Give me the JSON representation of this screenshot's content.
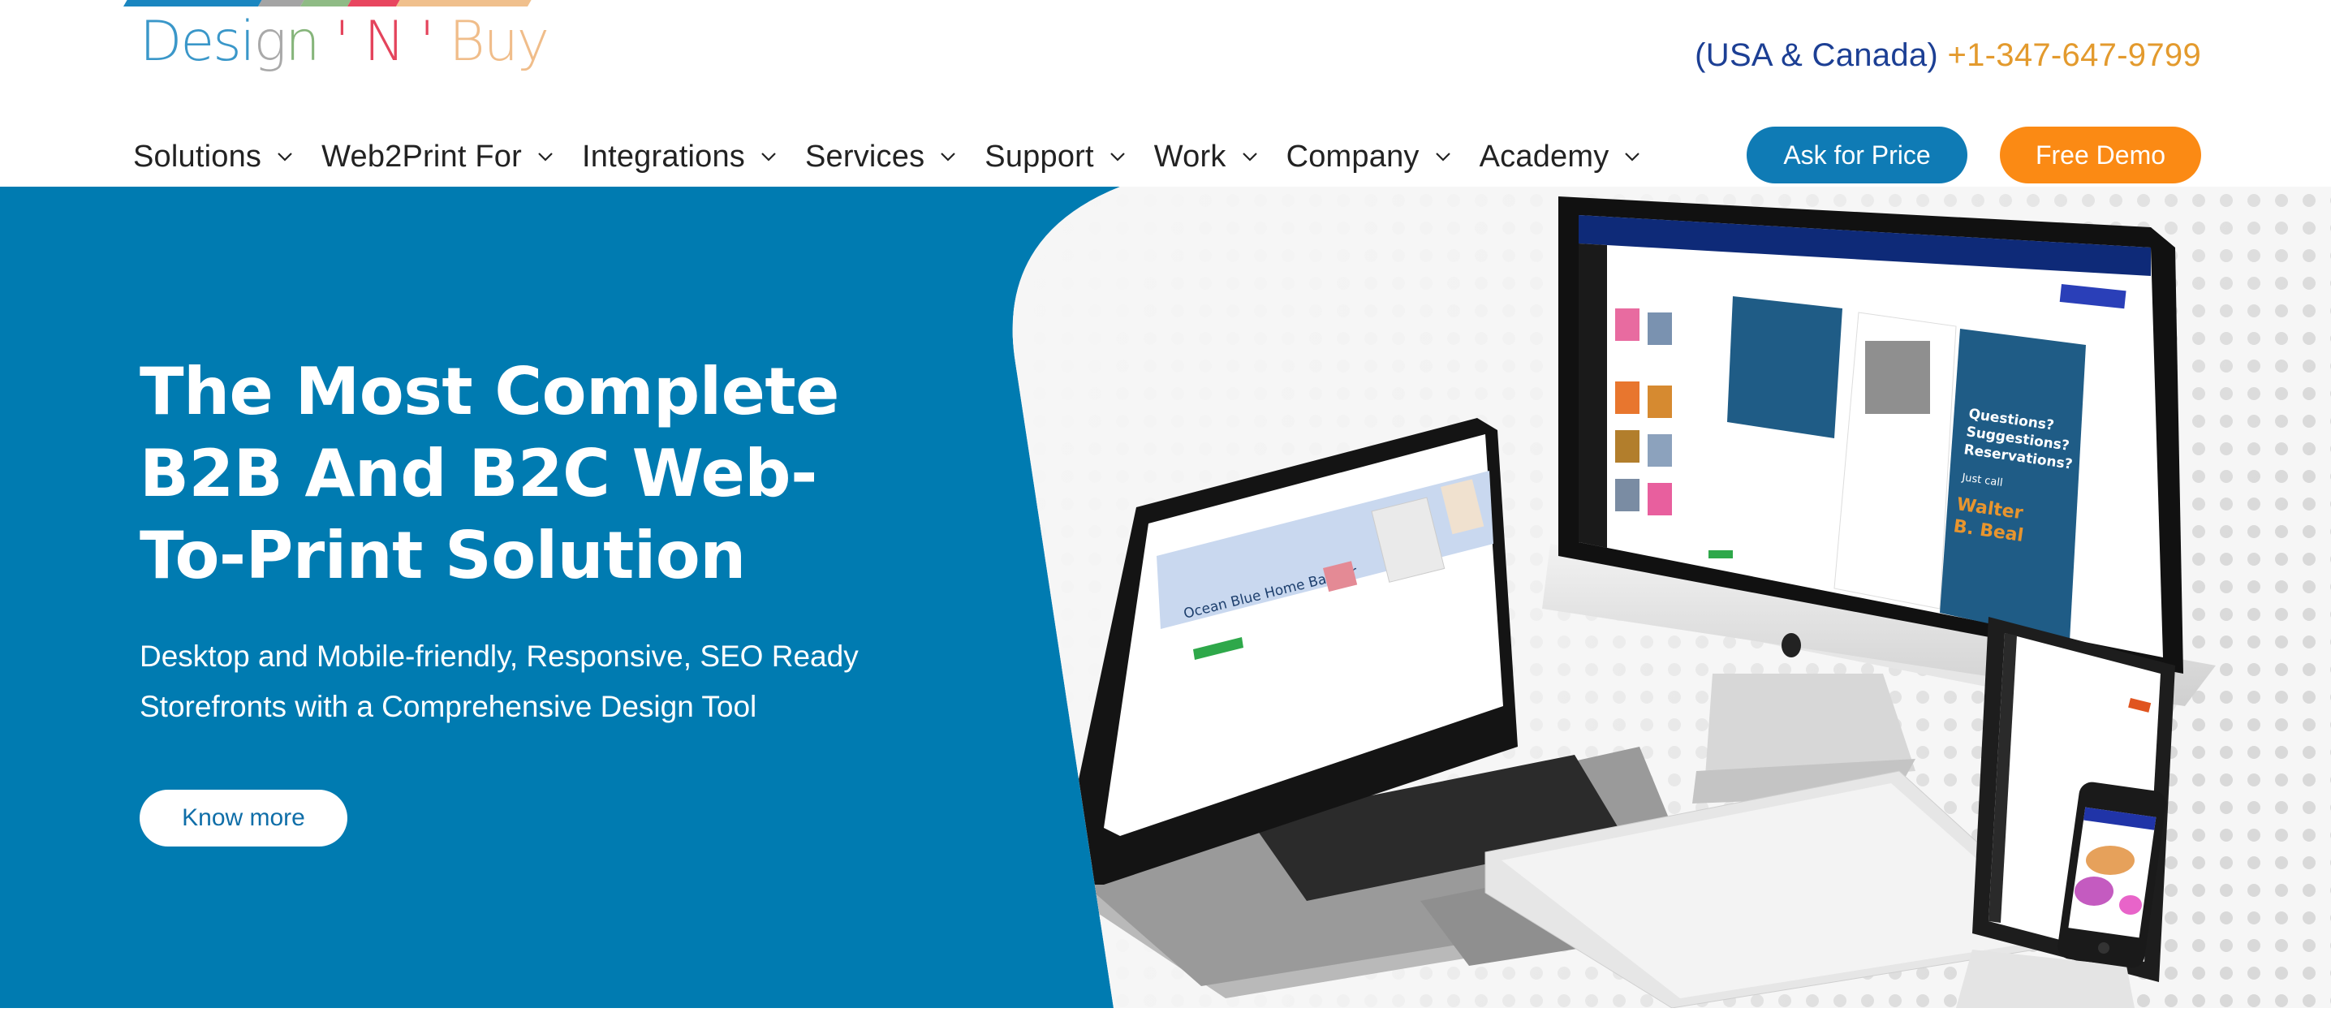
{
  "brand": {
    "logo_parts": [
      {
        "text": "Desi",
        "color": "#3a97c9"
      },
      {
        "text": "g",
        "color": "#a9a9a9"
      },
      {
        "text": "n",
        "color": "#86b57b"
      },
      {
        "text": " ' N ' ",
        "color": "#e4445c"
      },
      {
        "text": "Buy",
        "color": "#f0bd8a"
      }
    ],
    "stripe_colors": [
      "#1a86c0",
      "#a4a4a4",
      "#8fbb85",
      "#e8465f",
      "#f0c08d"
    ]
  },
  "contact": {
    "region": "(USA & Canada)",
    "phone": "+1-347-647-9799"
  },
  "nav": {
    "items": [
      {
        "label": "Solutions"
      },
      {
        "label": "Web2Print For"
      },
      {
        "label": "Integrations"
      },
      {
        "label": "Services"
      },
      {
        "label": "Support"
      },
      {
        "label": "Work"
      },
      {
        "label": "Company"
      },
      {
        "label": "Academy"
      }
    ],
    "ask_price_label": "Ask for Price",
    "free_demo_label": "Free Demo"
  },
  "hero": {
    "title_lines": [
      "The Most Complete",
      "B2B And B2C Web-",
      "To-Print Solution"
    ],
    "subtitle_lines": [
      "Desktop and Mobile-friendly, Responsive, SEO Ready",
      "Storefronts with a Comprehensive Design Tool"
    ],
    "cta_label": "Know more",
    "background_color": "#007bb1",
    "visual": {
      "laptop_banner_title": "Ocean Blue Home Banner",
      "monitor_brochure_lines": [
        "Questions?",
        "Suggestions?",
        "Reservations?"
      ],
      "monitor_brochure_call": "Just call",
      "monitor_brochure_name": [
        "Walter",
        "B. Beal"
      ]
    }
  },
  "colors": {
    "primary_blue": "#0f7bb5",
    "accent_orange": "#fb8a14",
    "region_text": "#1c3f94",
    "phone_text": "#e39a2d"
  }
}
